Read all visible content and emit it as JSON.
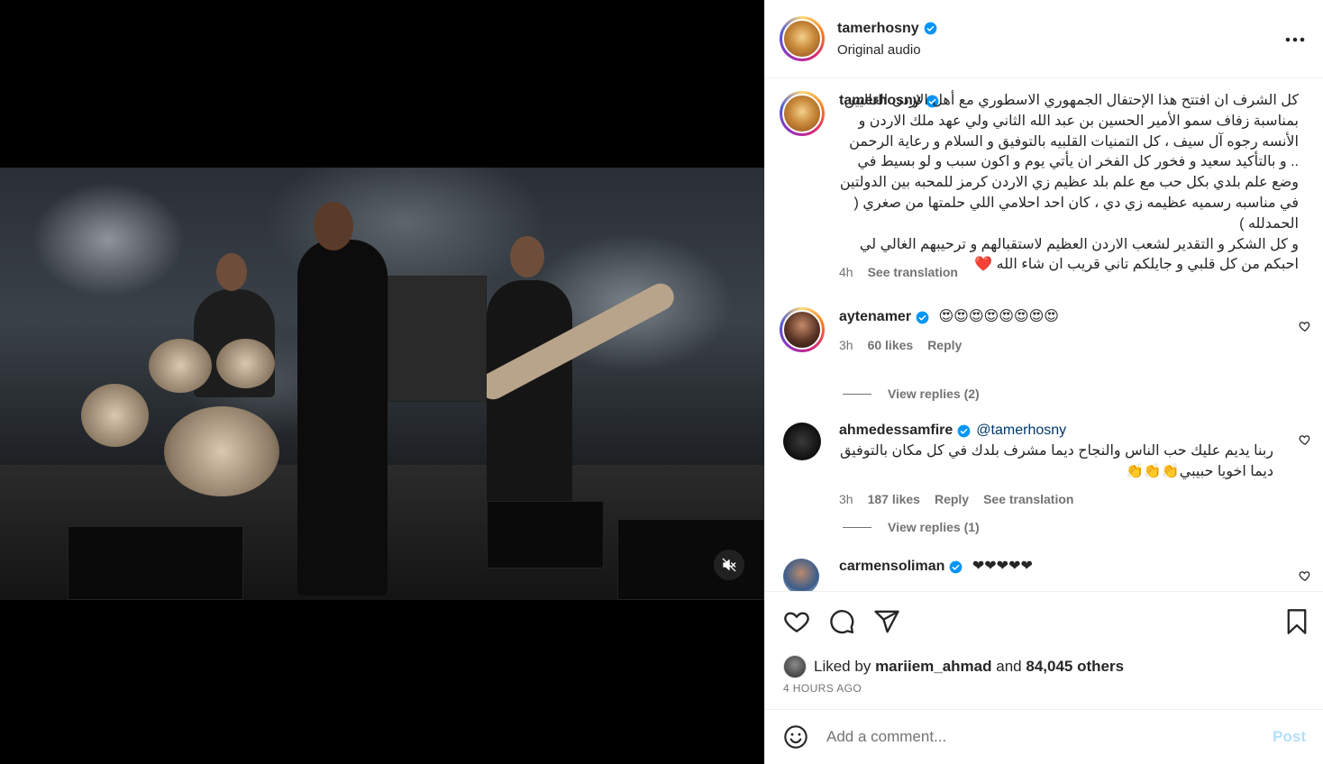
{
  "post": {
    "author": "tamerhosny",
    "subtitle": "Original audio",
    "caption_user": "tamerhosny",
    "caption": "كل الشرف ان افتتح هذا الإحتفال الجمهوري الاسطوري مع أهل الاردن الغاليين بمناسبة زفاف سمو الأمير الحسين بن عبد الله الثاني ولي عهد ملك الاردن و الأنسه رجوه آل سيف ، كل التمنيات القلبيه بالتوفيق و السلام و رعاية الرحمن .. و بالتأكيد سعيد و فخور كل الفخر ان يأتي يوم و اكون سبب و لو بسيط في وضع علم بلدي بكل حب مع علم بلد عظيم زي الاردن كرمز للمحبه بين الدولتين في مناسبه رسميه عظيمه زي دي ، كان احد احلامي اللي حلمتها من صغري ( الحمدلله )\nو كل الشكر و التقدير لشعب الاردن العظيم لاستقبالهم و ترحيبهم الغالي لي احبكم من كل قلبي و جايلكم تاني قريب ان شاء الله ❤️",
    "caption_time": "4h",
    "see_translation": "See translation"
  },
  "comments": [
    {
      "user": "aytenamer",
      "text": "😍😍😍😍😍😍😍😍",
      "time": "3h",
      "likes": "60 likes",
      "reply": "Reply",
      "view_replies": "View replies (2)"
    },
    {
      "user": "ahmedessamfire",
      "mention": "@tamerhosny",
      "text": "ربنا يديم عليك حب الناس والنجاح ديما مشرف بلدك في كل مكان بالتوفيق ديما اخويا حبيبي👏👏👏",
      "time": "3h",
      "likes": "187 likes",
      "reply": "Reply",
      "see_translation": "See translation",
      "view_replies": "View replies (1)"
    },
    {
      "user": "carmensoliman",
      "text": "❤❤❤❤❤"
    }
  ],
  "engagement": {
    "liked_prefix": "Liked by",
    "liked_user": "mariiem_ahmad",
    "liked_and": "and",
    "liked_others": "84,045 others",
    "time_ago": "4 HOURS AGO"
  },
  "composer": {
    "placeholder": "Add a comment...",
    "post_label": "Post"
  },
  "icons": {
    "more": "more-horizontal-icon",
    "mute": "volume-muted-icon",
    "like": "heart-icon",
    "comment": "comment-icon",
    "share": "share-icon",
    "save": "bookmark-icon",
    "emoji": "emoji-icon",
    "verified": "verified-badge-icon"
  },
  "colors": {
    "verified": "#0095f6",
    "post_button_disabled": "#b2dffc",
    "secondary_text": "#737373"
  }
}
